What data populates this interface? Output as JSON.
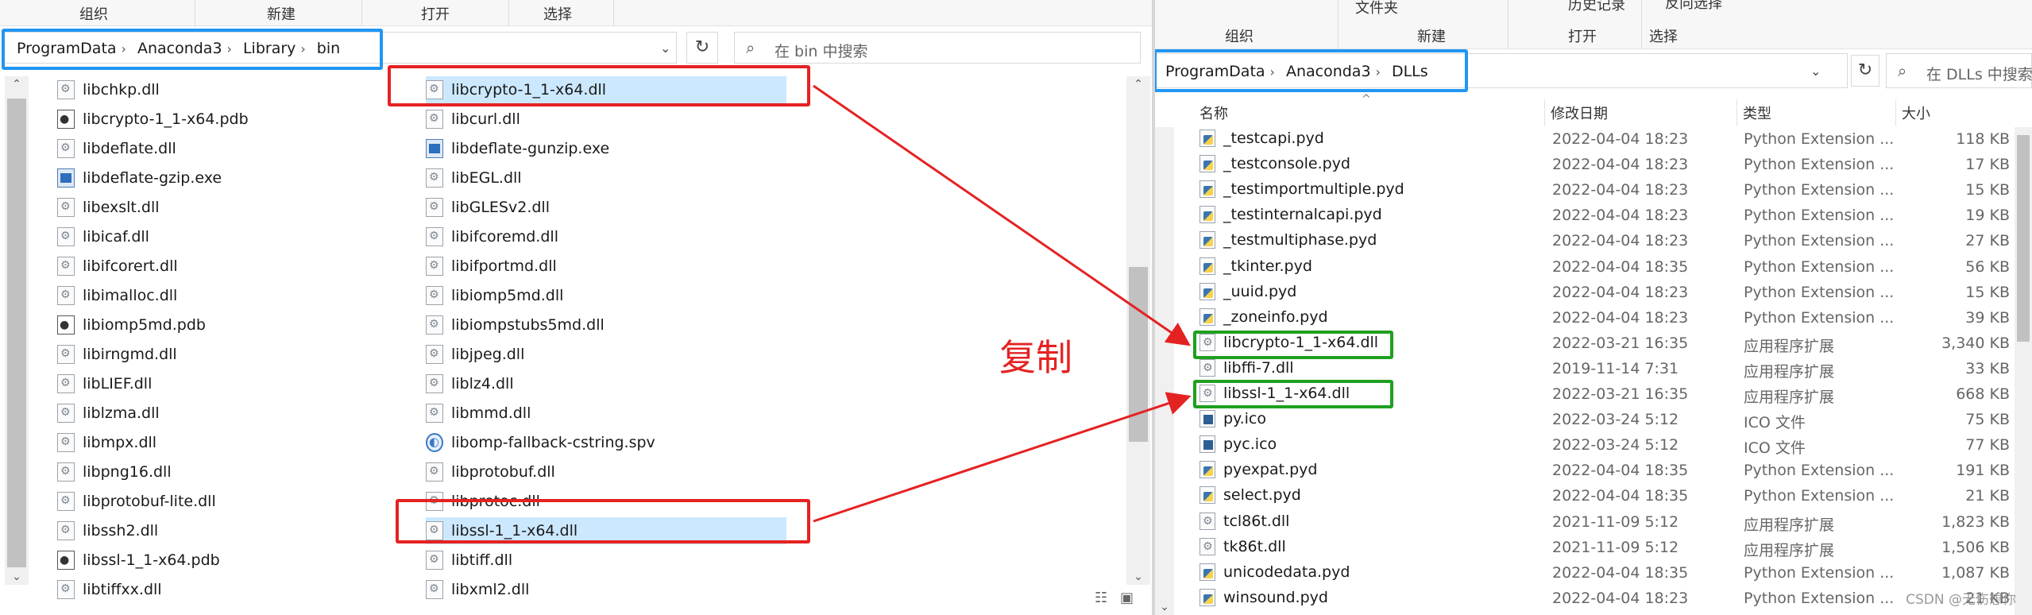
{
  "left": {
    "ribbon": [
      "组织",
      "新建",
      "打开",
      "选择"
    ],
    "breadcrumb": [
      "ProgramData",
      "Anaconda3",
      "Library",
      "bin"
    ],
    "search_placeholder": "在 bin 中搜索",
    "col1": [
      {
        "name": "libchkp.dll",
        "icon": "dll"
      },
      {
        "name": "libcrypto-1_1-x64.pdb",
        "icon": "pdb"
      },
      {
        "name": "libdeflate.dll",
        "icon": "dll"
      },
      {
        "name": "libdeflate-gzip.exe",
        "icon": "exe"
      },
      {
        "name": "libexslt.dll",
        "icon": "dll"
      },
      {
        "name": "libicaf.dll",
        "icon": "dll"
      },
      {
        "name": "libifcorert.dll",
        "icon": "dll"
      },
      {
        "name": "libimalloc.dll",
        "icon": "dll"
      },
      {
        "name": "libiomp5md.pdb",
        "icon": "pdb"
      },
      {
        "name": "libirngmd.dll",
        "icon": "dll"
      },
      {
        "name": "libLIEF.dll",
        "icon": "dll"
      },
      {
        "name": "liblzma.dll",
        "icon": "dll"
      },
      {
        "name": "libmpx.dll",
        "icon": "dll"
      },
      {
        "name": "libpng16.dll",
        "icon": "dll"
      },
      {
        "name": "libprotobuf-lite.dll",
        "icon": "dll"
      },
      {
        "name": "libssh2.dll",
        "icon": "dll"
      },
      {
        "name": "libssl-1_1-x64.pdb",
        "icon": "pdb"
      },
      {
        "name": "libtiffxx.dll",
        "icon": "dll"
      }
    ],
    "col2": [
      {
        "name": "libcrypto-1_1-x64.dll",
        "icon": "dll",
        "selected": true
      },
      {
        "name": "libcurl.dll",
        "icon": "dll"
      },
      {
        "name": "libdeflate-gunzip.exe",
        "icon": "exe"
      },
      {
        "name": "libEGL.dll",
        "icon": "dll"
      },
      {
        "name": "libGLESv2.dll",
        "icon": "dll"
      },
      {
        "name": "libifcoremd.dll",
        "icon": "dll"
      },
      {
        "name": "libifportmd.dll",
        "icon": "dll"
      },
      {
        "name": "libiomp5md.dll",
        "icon": "dll"
      },
      {
        "name": "libiompstubs5md.dll",
        "icon": "dll"
      },
      {
        "name": "libjpeg.dll",
        "icon": "dll"
      },
      {
        "name": "liblz4.dll",
        "icon": "dll"
      },
      {
        "name": "libmmd.dll",
        "icon": "dll"
      },
      {
        "name": "libomp-fallback-cstring.spv",
        "icon": "spv"
      },
      {
        "name": "libprotobuf.dll",
        "icon": "dll"
      },
      {
        "name": "libprotoc.dll",
        "icon": "dll"
      },
      {
        "name": "libssl-1_1-x64.dll",
        "icon": "dll",
        "selected": true
      },
      {
        "name": "libtiff.dll",
        "icon": "dll"
      },
      {
        "name": "libxml2.dll",
        "icon": "dll"
      }
    ]
  },
  "annotation": {
    "copy_label": "复制",
    "colors": {
      "red": "#e52222",
      "blue": "#2196f3",
      "green": "#1fa01f"
    }
  },
  "right": {
    "ribbon": {
      "file_content": "文件夹",
      "history": "历史记录",
      "reverse_select": "反向选择",
      "groups": [
        "组织",
        "新建",
        "打开",
        "选择"
      ]
    },
    "breadcrumb": [
      "ProgramData",
      "Anaconda3",
      "DLLs"
    ],
    "search_placeholder": "在 DLLs 中搜索",
    "headers": {
      "name": "名称",
      "date": "修改日期",
      "type": "类型",
      "size": "大小"
    },
    "rows": [
      {
        "name": "_testcapi.pyd",
        "date": "2022-04-04 18:23",
        "type": "Python Extension ...",
        "size": "118 KB",
        "icon": "pyd"
      },
      {
        "name": "_testconsole.pyd",
        "date": "2022-04-04 18:23",
        "type": "Python Extension ...",
        "size": "17 KB",
        "icon": "pyd"
      },
      {
        "name": "_testimportmultiple.pyd",
        "date": "2022-04-04 18:23",
        "type": "Python Extension ...",
        "size": "15 KB",
        "icon": "pyd"
      },
      {
        "name": "_testinternalcapi.pyd",
        "date": "2022-04-04 18:23",
        "type": "Python Extension ...",
        "size": "19 KB",
        "icon": "pyd"
      },
      {
        "name": "_testmultiphase.pyd",
        "date": "2022-04-04 18:23",
        "type": "Python Extension ...",
        "size": "27 KB",
        "icon": "pyd"
      },
      {
        "name": "_tkinter.pyd",
        "date": "2022-04-04 18:35",
        "type": "Python Extension ...",
        "size": "56 KB",
        "icon": "pyd"
      },
      {
        "name": "_uuid.pyd",
        "date": "2022-04-04 18:23",
        "type": "Python Extension ...",
        "size": "15 KB",
        "icon": "pyd"
      },
      {
        "name": "_zoneinfo.pyd",
        "date": "2022-04-04 18:23",
        "type": "Python Extension ...",
        "size": "39 KB",
        "icon": "pyd"
      },
      {
        "name": "libcrypto-1_1-x64.dll",
        "date": "2022-03-21 16:35",
        "type": "应用程序扩展",
        "size": "3,340 KB",
        "icon": "dll"
      },
      {
        "name": "libffi-7.dll",
        "date": "2019-11-14 7:31",
        "type": "应用程序扩展",
        "size": "33 KB",
        "icon": "dll"
      },
      {
        "name": "libssl-1_1-x64.dll",
        "date": "2022-03-21 16:35",
        "type": "应用程序扩展",
        "size": "668 KB",
        "icon": "dll"
      },
      {
        "name": "py.ico",
        "date": "2022-03-24 5:12",
        "type": "ICO 文件",
        "size": "75 KB",
        "icon": "ico"
      },
      {
        "name": "pyc.ico",
        "date": "2022-03-24 5:12",
        "type": "ICO 文件",
        "size": "77 KB",
        "icon": "ico"
      },
      {
        "name": "pyexpat.pyd",
        "date": "2022-04-04 18:35",
        "type": "Python Extension ...",
        "size": "191 KB",
        "icon": "pyd"
      },
      {
        "name": "select.pyd",
        "date": "2022-04-04 18:35",
        "type": "Python Extension ...",
        "size": "21 KB",
        "icon": "pyd"
      },
      {
        "name": "tcl86t.dll",
        "date": "2021-11-09 5:12",
        "type": "应用程序扩展",
        "size": "1,823 KB",
        "icon": "dll"
      },
      {
        "name": "tk86t.dll",
        "date": "2021-11-09 5:12",
        "type": "应用程序扩展",
        "size": "1,506 KB",
        "icon": "dll"
      },
      {
        "name": "unicodedata.pyd",
        "date": "2022-04-04 18:35",
        "type": "Python Extension ...",
        "size": "1,087 KB",
        "icon": "pyd"
      },
      {
        "name": "winsound.pyd",
        "date": "2022-04-04 18:23",
        "type": "Python Extension ...",
        "size": "21 KB",
        "icon": "pyd"
      }
    ],
    "watermark": "CSDN @无伤想你"
  }
}
